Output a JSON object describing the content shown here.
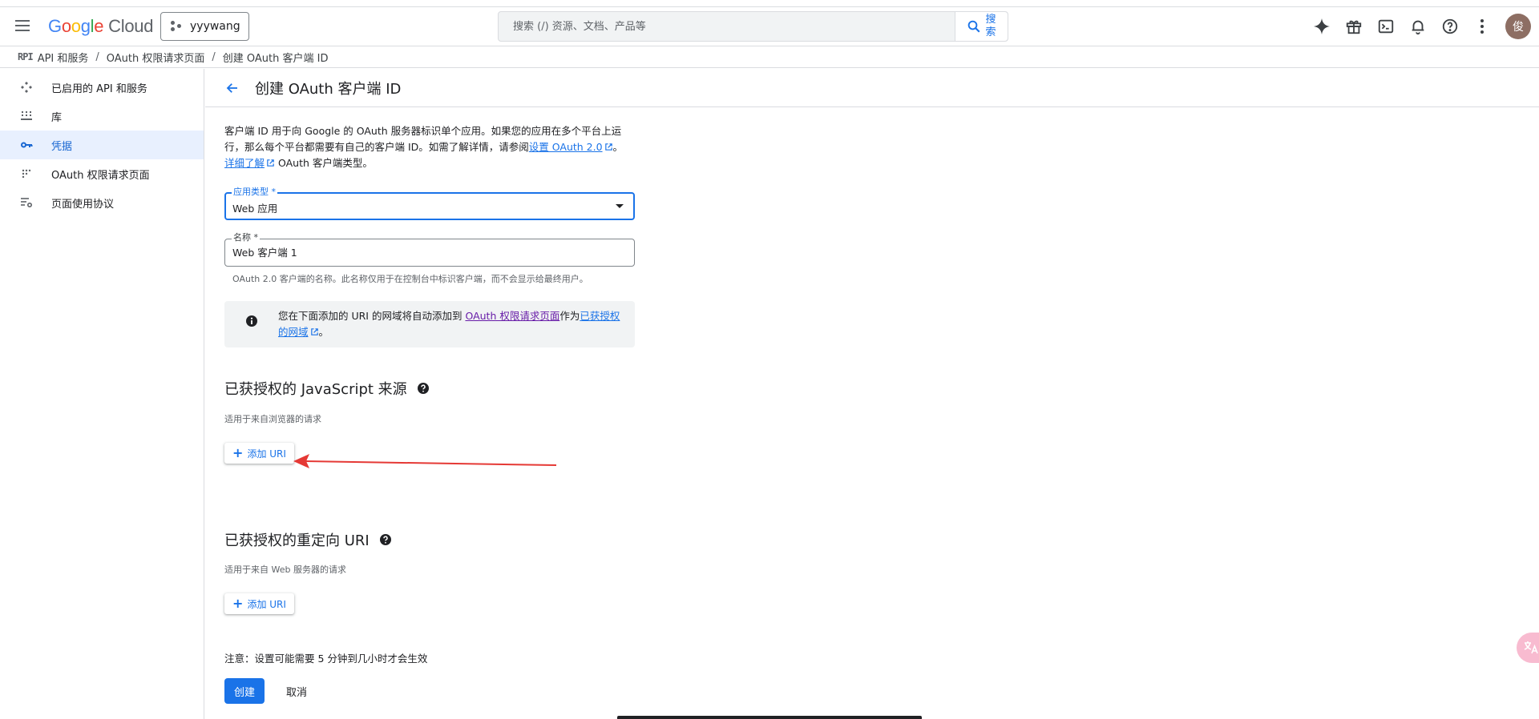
{
  "app": {
    "logo_google": [
      "G",
      "o",
      "o",
      "g",
      "l",
      "e"
    ],
    "logo_cloud": "Cloud",
    "project": "yyywang",
    "search_placeholder": "搜索 (/) 资源、文档、产品等",
    "search_button": "搜 索",
    "avatar_initial": "俊"
  },
  "breadcrumb": {
    "api_mark": "RPI",
    "items": [
      "API 和服务",
      "OAuth 权限请求页面",
      "创建 OAuth 客户端 ID"
    ]
  },
  "sidebar": {
    "items": [
      {
        "label": "已启用的 API 和服务",
        "icon": "api-services-icon"
      },
      {
        "label": "库",
        "icon": "library-icon"
      },
      {
        "label": "凭据",
        "icon": "key-icon"
      },
      {
        "label": "OAuth 权限请求页面",
        "icon": "consent-screen-icon"
      },
      {
        "label": "页面使用协议",
        "icon": "page-agreement-icon"
      }
    ],
    "active_index": 2
  },
  "page": {
    "title": "创建 OAuth 客户端 ID",
    "intro_part1": "客户端 ID 用于向 Google 的 OAuth 服务器标识单个应用。如果您的应用在多个平台上运行，那么每个平台都需要有自己的客户端 ID。如需了解详情，请参阅",
    "intro_link1": "设置 OAuth 2.0",
    "intro_part2": "。",
    "intro_link2": "详细了解",
    "intro_part3": " OAuth 客户端类型。",
    "app_type_label": "应用类型 *",
    "app_type_value": "Web 应用",
    "name_label": "名称 *",
    "name_value": "Web 客户端 1",
    "name_hint": "OAuth 2.0 客户端的名称。此名称仅用于在控制台中标识客户端，而不会显示给最终用户。",
    "info_part1": "您在下面添加的 URI 的网域将自动添加到 ",
    "info_link1": "OAuth 权限请求页面",
    "info_part2": "作为",
    "info_link2": "已获授权的网域",
    "info_part3": "。",
    "js_origins_title": "已获授权的 JavaScript 来源",
    "js_origins_sub": "适用于来自浏览器的请求",
    "add_uri_label": "添加 URI",
    "redirect_title": "已获授权的重定向 URI",
    "redirect_sub": "适用于来自 Web 服务器的请求",
    "note": "注意：设置可能需要 5 分钟到几小时才会生效",
    "create_button": "创建",
    "cancel_button": "取消"
  },
  "colors": {
    "accent": "#1a73e8",
    "annotation_arrow": "#e53935"
  }
}
